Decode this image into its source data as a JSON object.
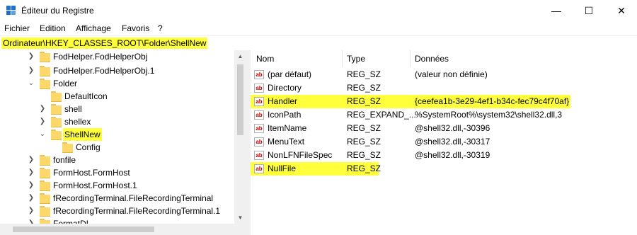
{
  "window": {
    "title": "Éditeur du Registre",
    "minimize": "—",
    "maximize": "☐",
    "close": "✕"
  },
  "menu": [
    "Fichier",
    "Edition",
    "Affichage",
    "Favoris",
    "?"
  ],
  "address": "Ordinateur\\HKEY_CLASSES_ROOT\\Folder\\ShellNew",
  "tree": [
    {
      "label": "FodHelper.FodHelperObj"
    },
    {
      "label": "FodHelper.FodHelperObj.1"
    },
    {
      "label": "Folder"
    },
    {
      "label": "DefaultIcon"
    },
    {
      "label": "shell"
    },
    {
      "label": "shellex"
    },
    {
      "label": "ShellNew"
    },
    {
      "label": "Config"
    },
    {
      "label": "fonfile"
    },
    {
      "label": "FormHost.FormHost"
    },
    {
      "label": "FormHost.FormHost.1"
    },
    {
      "label": "fRecordingTerminal.FileRecordingTerminal"
    },
    {
      "label": "fRecordingTerminal.FileRecordingTerminal.1"
    },
    {
      "label": "FormatDI..."
    }
  ],
  "columns": {
    "name": "Nom",
    "type": "Type",
    "data": "Données"
  },
  "values": [
    {
      "name": "(par défaut)",
      "type": "REG_SZ",
      "data": "(valeur non définie)",
      "icon": "ab"
    },
    {
      "name": "Directory",
      "type": "REG_SZ",
      "data": "",
      "icon": "ab"
    },
    {
      "name": "Handler",
      "type": "REG_SZ",
      "data": "{ceefea1b-3e29-4ef1-b34c-fec79c4f70af}",
      "icon": "ab"
    },
    {
      "name": "IconPath",
      "type": "REG_EXPAND_...",
      "data": "%SystemRoot%\\system32\\shell32.dll,3",
      "icon": "ab"
    },
    {
      "name": "ItemName",
      "type": "REG_SZ",
      "data": "@shell32.dll,-30396",
      "icon": "ab"
    },
    {
      "name": "MenuText",
      "type": "REG_SZ",
      "data": "@shell32.dll,-30317",
      "icon": "ab"
    },
    {
      "name": "NonLFNFileSpec",
      "type": "REG_SZ",
      "data": "@shell32.dll,-30319",
      "icon": "ab"
    },
    {
      "name": "NullFile",
      "type": "REG_SZ",
      "data": "",
      "icon": "ab"
    }
  ],
  "colors": {
    "highlight": "#ffff3c",
    "folder": "#fcd86a",
    "icon_red": "#c00000"
  },
  "icons": {
    "app": "registry-editor-icon",
    "folder": "folder-icon",
    "string_value": "ab-string-icon",
    "expand": "chevron-right-icon",
    "collapse": "chevron-down-icon"
  }
}
